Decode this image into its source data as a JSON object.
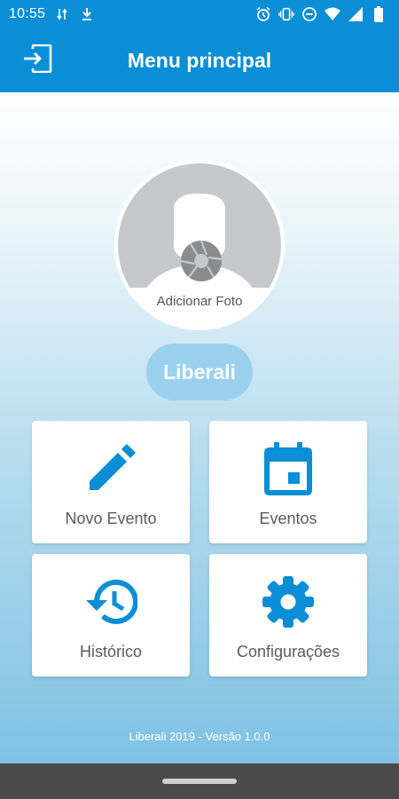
{
  "status_bar": {
    "time": "10:55",
    "left_icons": [
      "data-transfer-icon",
      "download-icon"
    ],
    "right_icons": [
      "alarm-icon",
      "vibrate-icon",
      "do-not-disturb-icon",
      "wifi-icon",
      "signal-icon",
      "battery-icon"
    ]
  },
  "app_bar": {
    "title": "Menu principal",
    "logout_icon": "logout-icon",
    "color": "#0a8ed6"
  },
  "profile": {
    "avatar_label": "Adicionar Foto",
    "name": "Liberali"
  },
  "menu": {
    "accent_color": "#0a8ed6",
    "tiles": [
      {
        "label": "Novo Evento",
        "icon": "pencil-icon"
      },
      {
        "label": "Eventos",
        "icon": "calendar-icon"
      },
      {
        "label": "Histórico",
        "icon": "history-icon"
      },
      {
        "label": "Configurações",
        "icon": "gear-icon"
      }
    ]
  },
  "footer": {
    "text": "Liberali 2019 - Versão 1.0.0"
  }
}
